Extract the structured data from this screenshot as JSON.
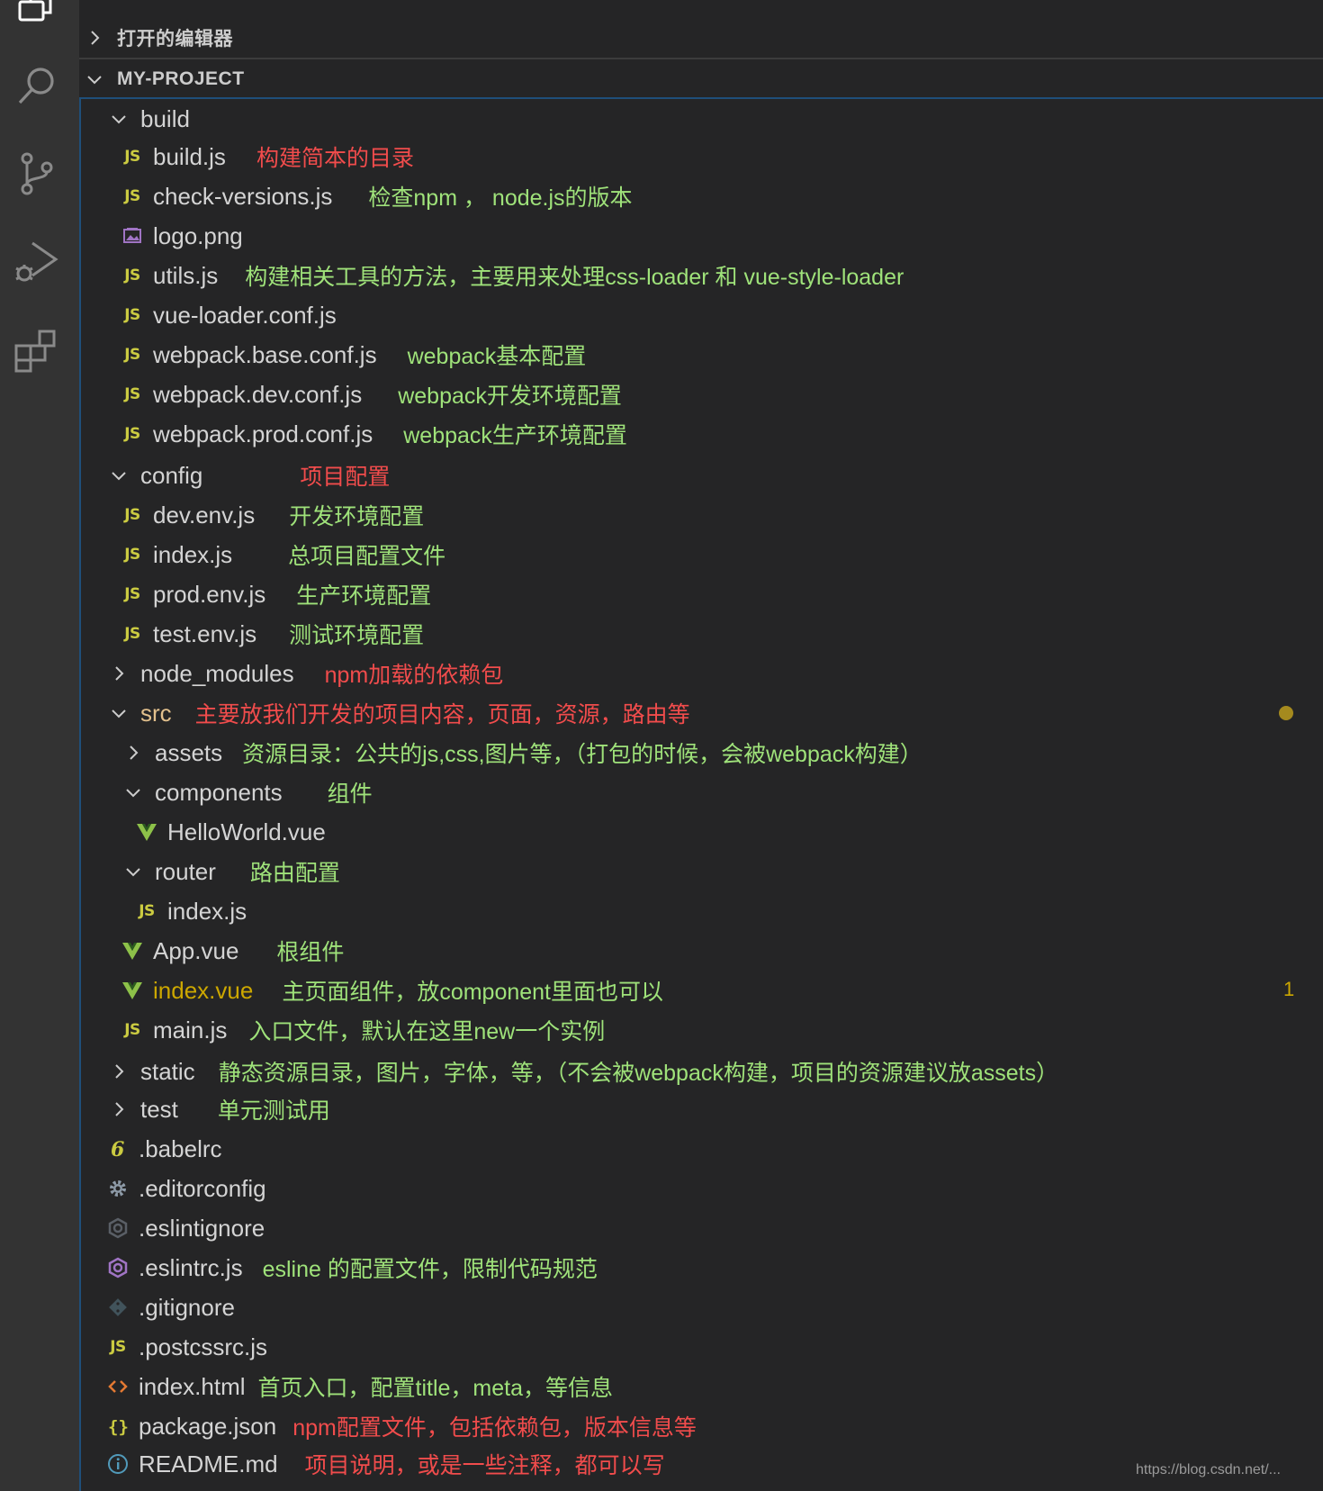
{
  "activity_bar": {
    "items": [
      {
        "icon": "files-icon"
      },
      {
        "icon": "search-icon"
      },
      {
        "icon": "source-control-icon"
      },
      {
        "icon": "run-debug-icon"
      },
      {
        "icon": "extensions-icon"
      }
    ]
  },
  "explorer": {
    "open_editors_label": "打开的编辑器",
    "project_label": "MY-PROJECT",
    "tree": [
      {
        "name": "build",
        "kind": "folder",
        "expanded": true,
        "note": ""
      },
      {
        "name": "build.js",
        "kind": "js",
        "note": "构建简本的目录"
      },
      {
        "name": "check-versions.js",
        "kind": "js",
        "note": "检查npm ， node.js的版本"
      },
      {
        "name": "logo.png",
        "kind": "image",
        "note": ""
      },
      {
        "name": "utils.js",
        "kind": "js",
        "note": "构建相关工具的方法，主要用来处理css-loader 和 vue-style-loader"
      },
      {
        "name": "vue-loader.conf.js",
        "kind": "js",
        "note": ""
      },
      {
        "name": "webpack.base.conf.js",
        "kind": "js",
        "note": "webpack基本配置"
      },
      {
        "name": "webpack.dev.conf.js",
        "kind": "js",
        "note": "webpack开发环境配置"
      },
      {
        "name": "webpack.prod.conf.js",
        "kind": "js",
        "note": "webpack生产环境配置"
      },
      {
        "name": "config",
        "kind": "folder",
        "expanded": true,
        "note": "项目配置"
      },
      {
        "name": "dev.env.js",
        "kind": "js",
        "note": "开发环境配置"
      },
      {
        "name": "index.js",
        "kind": "js",
        "note": "总项目配置文件"
      },
      {
        "name": "prod.env.js",
        "kind": "js",
        "note": "生产环境配置"
      },
      {
        "name": "test.env.js",
        "kind": "js",
        "note": "测试环境配置"
      },
      {
        "name": "node_modules",
        "kind": "folder",
        "expanded": false,
        "note": "npm加载的依赖包"
      },
      {
        "name": "src",
        "kind": "folder",
        "expanded": true,
        "note": "主要放我们开发的项目内容，页面，资源，路由等"
      },
      {
        "name": "assets",
        "kind": "folder",
        "expanded": false,
        "note": "资源目录：公共的js,css,图片等，（打包的时候，会被webpack构建）"
      },
      {
        "name": "components",
        "kind": "folder",
        "expanded": true,
        "note": "组件"
      },
      {
        "name": "HelloWorld.vue",
        "kind": "vue",
        "note": ""
      },
      {
        "name": "router",
        "kind": "folder",
        "expanded": true,
        "note": "路由配置"
      },
      {
        "name": "index.js",
        "kind": "js",
        "note": ""
      },
      {
        "name": "App.vue",
        "kind": "vue",
        "note": "根组件"
      },
      {
        "name": "index.vue",
        "kind": "vue",
        "note": "主页面组件，放component里面也可以"
      },
      {
        "name": "main.js",
        "kind": "js",
        "note": "入口文件，默认在这里new一个实例"
      },
      {
        "name": "static",
        "kind": "folder",
        "expanded": false,
        "note": "静态资源目录，图片，字体，等，（不会被webpack构建，项目的资源建议放assets）"
      },
      {
        "name": "test",
        "kind": "folder",
        "expanded": false,
        "note": "单元测试用"
      },
      {
        "name": ".babelrc",
        "kind": "babel",
        "note": ""
      },
      {
        "name": ".editorconfig",
        "kind": "gear",
        "note": ""
      },
      {
        "name": ".eslintignore",
        "kind": "eslint-dim",
        "note": ""
      },
      {
        "name": ".eslintrc.js",
        "kind": "eslint",
        "note": "esline 的配置文件，限制代码规范"
      },
      {
        "name": ".gitignore",
        "kind": "git",
        "note": ""
      },
      {
        "name": ".postcssrc.js",
        "kind": "js",
        "note": ""
      },
      {
        "name": "index.html",
        "kind": "html",
        "note": "首页入口，配置title，meta，等信息"
      },
      {
        "name": "package.json",
        "kind": "json",
        "note": "npm配置文件，包括依赖包，版本信息等"
      },
      {
        "name": "README.md",
        "kind": "info",
        "note": "项目说明，或是一些注释，都可以写"
      }
    ],
    "src_modified_dot": true,
    "index_vue_problem_count": "1"
  },
  "colors": {
    "note_green": "#9fe27a",
    "note_red": "#f14c4c",
    "js_yellow": "#cbcb41",
    "vue_green": "#8dc149",
    "warning": "#cca700"
  },
  "watermark": "https://blog.csdn.net/..."
}
